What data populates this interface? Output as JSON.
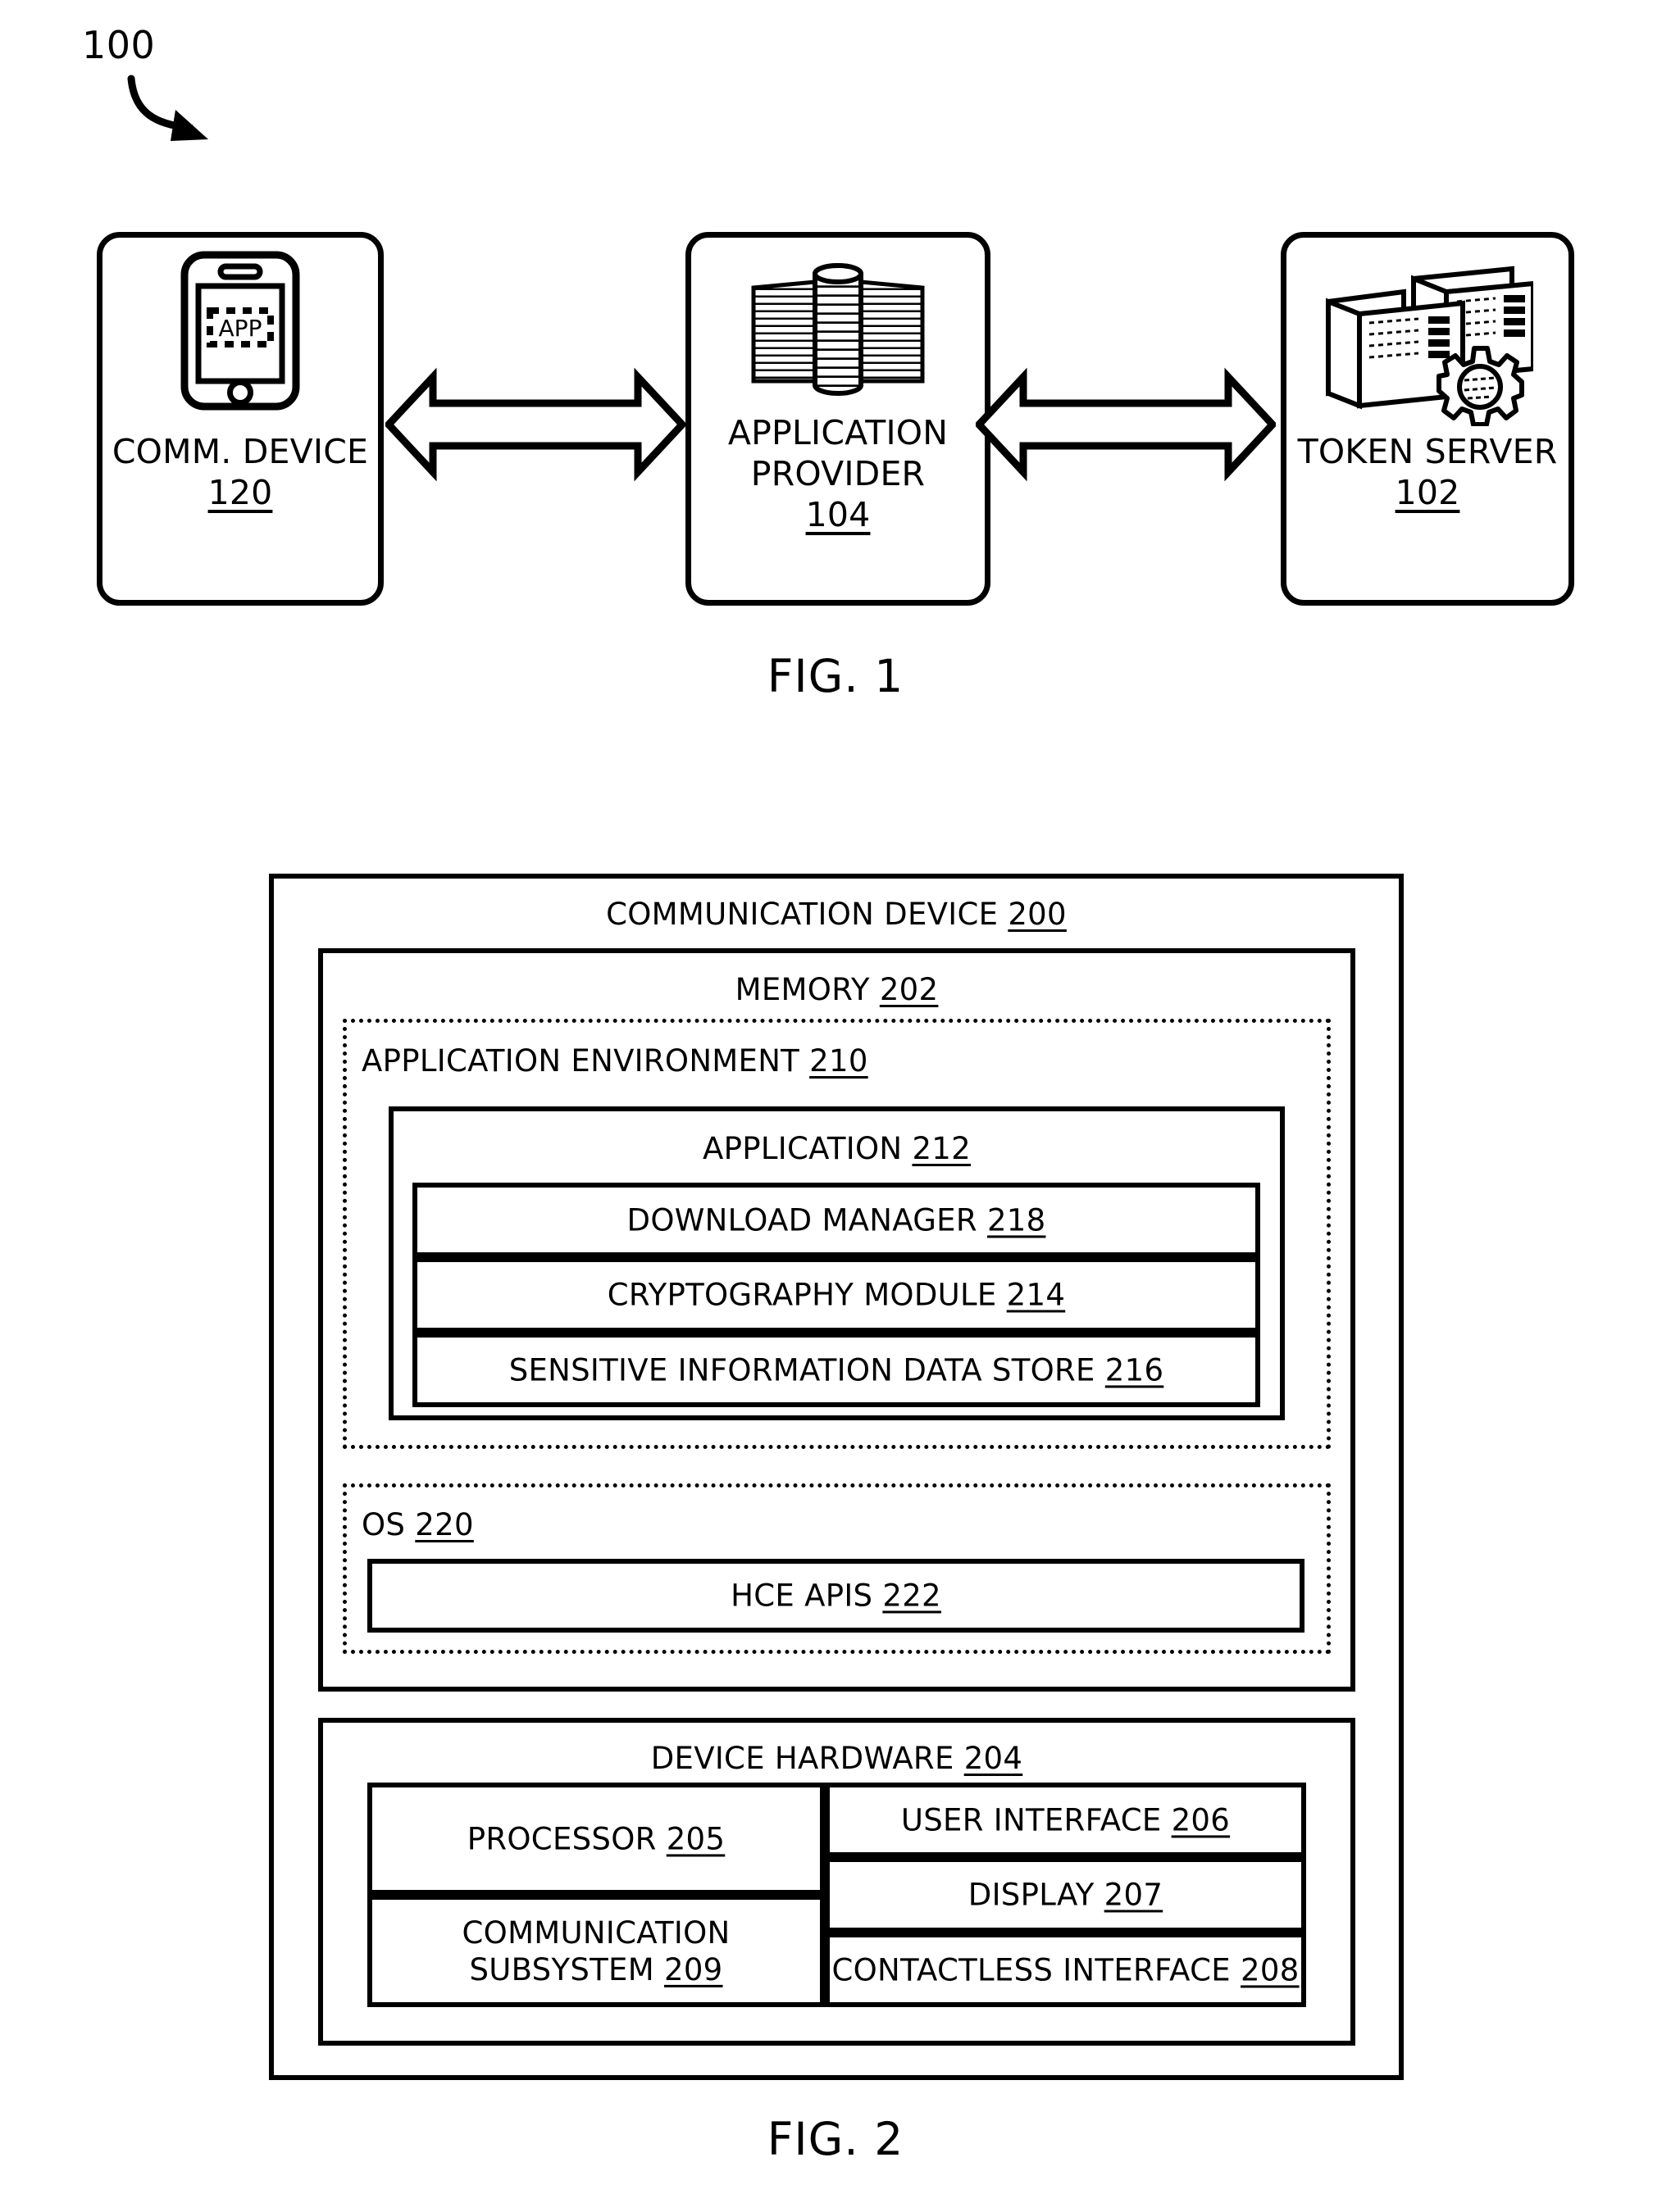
{
  "figure1": {
    "ref_number": "100",
    "caption": "FIG. 1",
    "nodes": [
      {
        "id": "comm-device",
        "icon": "mobile-phone-icon",
        "screen_label": "APP",
        "label": "COMM. DEVICE",
        "number": "120"
      },
      {
        "id": "application-provider",
        "icon": "server-stack-icon",
        "label_line1": "APPLICATION",
        "label_line2": "PROVIDER",
        "number": "104"
      },
      {
        "id": "token-server",
        "icon": "server-rack-gear-icon",
        "label": "TOKEN SERVER",
        "number": "102"
      }
    ],
    "connectors": [
      {
        "id": "comm-to-provider",
        "type": "double-headed-arrow"
      },
      {
        "id": "provider-to-token",
        "type": "double-headed-arrow"
      }
    ]
  },
  "figure2": {
    "caption": "FIG. 2",
    "outer": {
      "label": "COMMUNICATION DEVICE",
      "number": "200"
    },
    "memory": {
      "label": "MEMORY",
      "number": "202"
    },
    "application_environment": {
      "label": "APPLICATION ENVIRONMENT",
      "number": "210"
    },
    "application": {
      "label": "APPLICATION",
      "number": "212"
    },
    "application_modules": [
      {
        "label": "DOWNLOAD MANAGER",
        "number": "218"
      },
      {
        "label": "CRYPTOGRAPHY MODULE",
        "number": "214"
      },
      {
        "label": "SENSITIVE INFORMATION DATA STORE",
        "number": "216"
      }
    ],
    "os": {
      "label": "OS",
      "number": "220"
    },
    "hce_apis": {
      "label": "HCE APIS",
      "number": "222"
    },
    "device_hardware": {
      "label": "DEVICE HARDWARE",
      "number": "204"
    },
    "hardware_left": [
      {
        "label": "PROCESSOR",
        "number": "205"
      },
      {
        "label_line1": "COMMUNICATION",
        "label_line2": "SUBSYSTEM",
        "number": "209"
      }
    ],
    "hardware_right": [
      {
        "label": "USER INTERFACE",
        "number": "206"
      },
      {
        "label": "DISPLAY",
        "number": "207"
      },
      {
        "label": "CONTACTLESS INTERFACE",
        "number": "208"
      }
    ]
  },
  "colors": {
    "ink": "#000000",
    "paper": "#ffffff"
  }
}
